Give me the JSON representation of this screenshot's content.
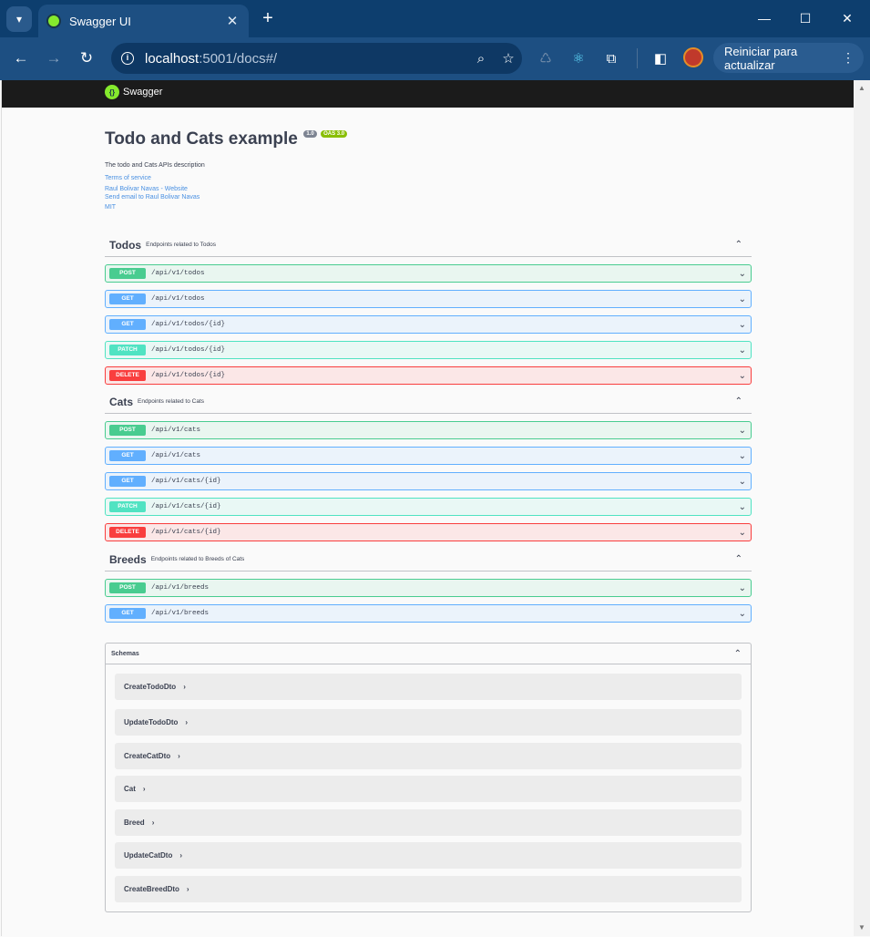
{
  "browser": {
    "tab_title": "Swagger UI",
    "url_host": "localhost",
    "url_rest": ":5001/docs#/",
    "update_label": "Reiniciar para actualizar"
  },
  "swagger": {
    "logo_text": "Swagger",
    "title": "Todo and Cats example",
    "version": "1.0",
    "oas": "OAS 3.0",
    "description": "The todo and Cats APIs description",
    "links": [
      "Terms of service",
      "Raul Bolivar Navas - Website",
      "Send email to Raul Bolivar Navas",
      "MIT"
    ]
  },
  "tags": [
    {
      "name": "Todos",
      "description": "Endpoints related to Todos",
      "operations": [
        {
          "method": "POST",
          "path": "/api/v1/todos"
        },
        {
          "method": "GET",
          "path": "/api/v1/todos"
        },
        {
          "method": "GET",
          "path": "/api/v1/todos/{id}"
        },
        {
          "method": "PATCH",
          "path": "/api/v1/todos/{id}"
        },
        {
          "method": "DELETE",
          "path": "/api/v1/todos/{id}"
        }
      ]
    },
    {
      "name": "Cats",
      "description": "Endpoints related to Cats",
      "operations": [
        {
          "method": "POST",
          "path": "/api/v1/cats"
        },
        {
          "method": "GET",
          "path": "/api/v1/cats"
        },
        {
          "method": "GET",
          "path": "/api/v1/cats/{id}"
        },
        {
          "method": "PATCH",
          "path": "/api/v1/cats/{id}"
        },
        {
          "method": "DELETE",
          "path": "/api/v1/cats/{id}"
        }
      ]
    },
    {
      "name": "Breeds",
      "description": "Endpoints related to Breeds of Cats",
      "operations": [
        {
          "method": "POST",
          "path": "/api/v1/breeds"
        },
        {
          "method": "GET",
          "path": "/api/v1/breeds"
        }
      ]
    }
  ],
  "schemas": {
    "title": "Schemas",
    "models": [
      "CreateTodoDto",
      "UpdateTodoDto",
      "CreateCatDto",
      "Cat",
      "Breed",
      "UpdateCatDto",
      "CreateBreedDto"
    ]
  }
}
